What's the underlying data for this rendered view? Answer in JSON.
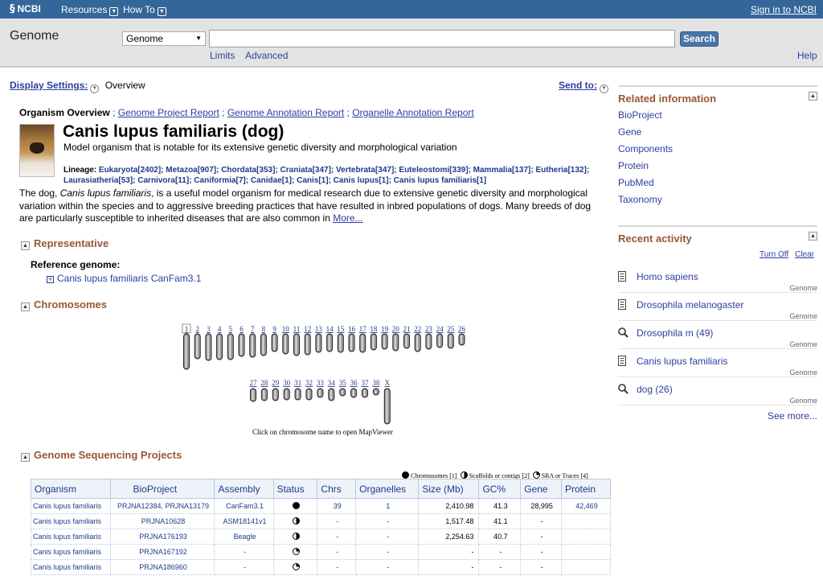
{
  "topbar": {
    "logo": "NCBI",
    "menus": [
      "Resources",
      "How To"
    ],
    "signin": "Sign in to NCBI"
  },
  "search": {
    "db_title": "Genome",
    "select_value": "Genome",
    "query": "",
    "button": "Search",
    "limits": "Limits",
    "advanced": "Advanced",
    "help": "Help"
  },
  "display": {
    "settings_label": "Display Settings:",
    "settings_value": "Overview",
    "send_to": "Send to:"
  },
  "overview": {
    "label": "Organism Overview",
    "links": [
      "Genome Project Report",
      "Genome Annotation Report",
      "Organelle Annotation Report"
    ],
    "title": "Canis lupus familiaris (dog)",
    "subtitle": "Model organism that is notable for its extensive genetic diversity and morphological variation",
    "lineage_label": "Lineage:",
    "lineage": [
      "Eukaryota[2402]",
      "Metazoa[907]",
      "Chordata[353]",
      "Craniata[347]",
      "Vertebrata[347]",
      "Euteleostomi[339]",
      "Mammalia[137]",
      "Eutheria[132]",
      "Laurasiatheria[53]",
      "Carnivora[11]",
      "Caniformia[7]",
      "Canidae[1]",
      "Canis[1]",
      "Canis lupus[1]",
      "Canis lupus familiaris[1]"
    ],
    "desc_1": "The dog, ",
    "desc_italic": "Canis lupus familiaris",
    "desc_2": ", is a useful model organism for medical research due to extensive genetic diversity and morphological variation within the species and to aggressive breeding practices that have resulted in inbred populations of dogs. Many breeds of dog are particularly susceptible to inherited diseases that are also common in ",
    "more": "More..."
  },
  "representative": {
    "heading": "Representative",
    "ref_label": "Reference genome:",
    "ref_item": "Canis lupus familiaris CanFam3.1"
  },
  "chromosomes": {
    "heading": "Chromosomes",
    "caption": "Click on chromosome name to open MapViewer",
    "row1": [
      {
        "label": "1",
        "len": 122
      },
      {
        "label": "2",
        "len": 85
      },
      {
        "label": "3",
        "len": 92
      },
      {
        "label": "4",
        "len": 88
      },
      {
        "label": "5",
        "len": 89
      },
      {
        "label": "6",
        "len": 77
      },
      {
        "label": "7",
        "len": 81
      },
      {
        "label": "8",
        "len": 74
      },
      {
        "label": "9",
        "len": 61
      },
      {
        "label": "10",
        "len": 70
      },
      {
        "label": "11",
        "len": 74
      },
      {
        "label": "12",
        "len": 72
      },
      {
        "label": "13",
        "len": 63
      },
      {
        "label": "14",
        "len": 61
      },
      {
        "label": "15",
        "len": 64
      },
      {
        "label": "16",
        "len": 60
      },
      {
        "label": "17",
        "len": 64
      },
      {
        "label": "18",
        "len": 55
      },
      {
        "label": "19",
        "len": 53
      },
      {
        "label": "20",
        "len": 58
      },
      {
        "label": "21",
        "len": 51
      },
      {
        "label": "22",
        "len": 61
      },
      {
        "label": "23",
        "len": 52
      },
      {
        "label": "24",
        "len": 47
      },
      {
        "label": "25",
        "len": 51
      },
      {
        "label": "26",
        "len": 38
      }
    ],
    "row2": [
      {
        "label": "27",
        "len": 45
      },
      {
        "label": "28",
        "len": 41
      },
      {
        "label": "29",
        "len": 41
      },
      {
        "label": "30",
        "len": 40
      },
      {
        "label": "31",
        "len": 39
      },
      {
        "label": "32",
        "len": 38
      },
      {
        "label": "33",
        "len": 31
      },
      {
        "label": "34",
        "len": 42
      },
      {
        "label": "35",
        "len": 26
      },
      {
        "label": "36",
        "len": 30
      },
      {
        "label": "37",
        "len": 30
      },
      {
        "label": "38",
        "len": 23
      },
      {
        "label": "X",
        "len": 123
      }
    ]
  },
  "sequencing": {
    "heading": "Genome Sequencing Projects",
    "legend": [
      "Chromosomes [1]",
      "Scaffolds or contigs [2]",
      "SRA or Traces [4]"
    ],
    "columns": [
      "Organism",
      "BioProject",
      "Assembly",
      "Status",
      "Chrs",
      "Organelles",
      "Size (Mb)",
      "GC%",
      "Gene",
      "Protein"
    ],
    "rows": [
      {
        "organism": "Canis lupus familiaris",
        "bioproject": "PRJNA12384, PRJNA13179",
        "assembly": "CanFam3.1",
        "status": "chromosomes",
        "chrs": "39",
        "organelles": "1",
        "size": "2,410.98",
        "gc": "41.3",
        "gene": "28,995",
        "protein": "42,469"
      },
      {
        "organism": "Canis lupus familiaris",
        "bioproject": "PRJNA10628",
        "assembly": "ASM18141v1",
        "status": "scaffolds",
        "chrs": "-",
        "organelles": "-",
        "size": "1,517.48",
        "gc": "41.1",
        "gene": "-",
        "protein": ""
      },
      {
        "organism": "Canis lupus familiaris",
        "bioproject": "PRJNA176193",
        "assembly": "Beagle",
        "status": "scaffolds",
        "chrs": "-",
        "organelles": "-",
        "size": "2,254.63",
        "gc": "40.7",
        "gene": "-",
        "protein": ""
      },
      {
        "organism": "Canis lupus familiaris",
        "bioproject": "PRJNA167192",
        "assembly": "-",
        "status": "sra",
        "chrs": "-",
        "organelles": "-",
        "size": "-",
        "gc": "-",
        "gene": "-",
        "protein": ""
      },
      {
        "organism": "Canis lupus familiaris",
        "bioproject": "PRJNA186960",
        "assembly": "-",
        "status": "sra",
        "chrs": "-",
        "organelles": "-",
        "size": "-",
        "gc": "-",
        "gene": "-",
        "protein": ""
      }
    ]
  },
  "related": {
    "heading": "Related information",
    "items": [
      "BioProject",
      "Gene",
      "Components",
      "Protein",
      "PubMed",
      "Taxonomy"
    ]
  },
  "recent": {
    "heading": "Recent activity",
    "turn_off": "Turn Off",
    "clear": "Clear",
    "items": [
      {
        "text": "Homo sapiens",
        "db": "Genome",
        "icon": "document-icon"
      },
      {
        "text": "Drosophila melanogaster",
        "db": "Genome",
        "icon": "document-icon"
      },
      {
        "text": "Drosophila m (49)",
        "db": "Genome",
        "icon": "magnifier-icon"
      },
      {
        "text": "Canis lupus familiaris",
        "db": "Genome",
        "icon": "document-icon"
      },
      {
        "text": "dog (26)",
        "db": "Genome",
        "icon": "magnifier-icon"
      }
    ],
    "see_more": "See more..."
  },
  "colors": {
    "topbar": "#336699",
    "section_heading": "#985735",
    "link": "#2c3e9e"
  }
}
